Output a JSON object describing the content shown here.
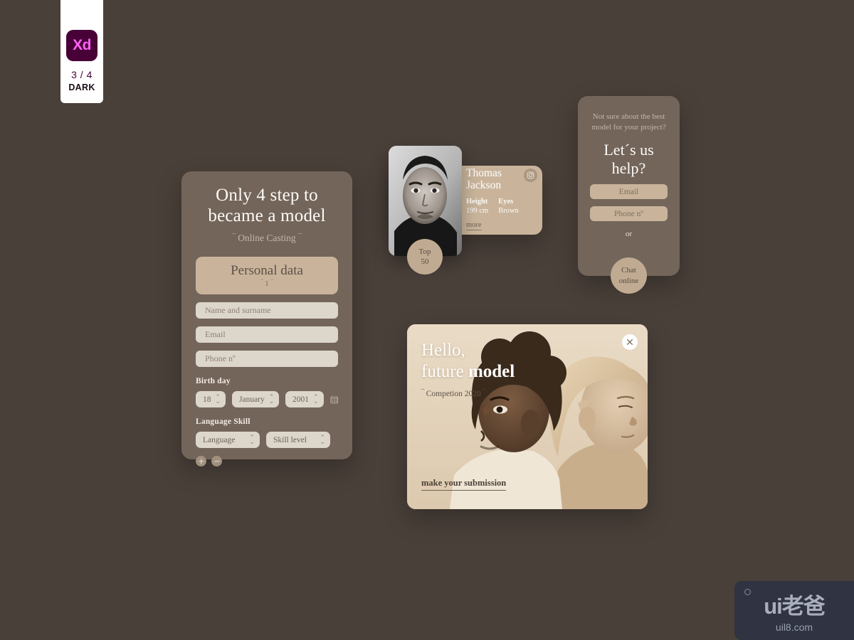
{
  "badge": {
    "app": "Xd",
    "count": "3 / 4",
    "mode": "DARK"
  },
  "steps_card": {
    "title": "Only 4 step to became a model",
    "subtitle": "‾ Online Casting ‾",
    "step_button": {
      "label": "Personal data",
      "step": "‾ 1 ‾"
    },
    "inputs": [
      {
        "name": "name-surname",
        "placeholder": "Name and surname",
        "value": ""
      },
      {
        "name": "email",
        "placeholder": "Email",
        "value": ""
      },
      {
        "name": "phone",
        "placeholder": "Phone nº",
        "value": ""
      }
    ],
    "birthday": {
      "label": "Birth day",
      "day": "18",
      "month": "January",
      "year": "2001"
    },
    "language": {
      "label": "Language Skill",
      "language_value": "Language",
      "skill_value": "Skill level"
    }
  },
  "model_card": {
    "name": "Thomas Jackson",
    "specs": [
      {
        "label": "Height",
        "value": "199 cm"
      },
      {
        "label": "Eyes",
        "value": "Brown"
      }
    ],
    "more_label": "more",
    "badge": {
      "line1": "Top",
      "line2": "50"
    }
  },
  "help_card": {
    "intro": "Not sure about the best model for your project?",
    "title": "Let´s us help?",
    "email_placeholder": "Email",
    "phone_placeholder": "Phone nº",
    "or_label": "or",
    "chat_button": {
      "line1": "Chat",
      "line2": "online"
    }
  },
  "hero_card": {
    "title_light": "Hello,",
    "title_mixed_light": "future ",
    "title_mixed_bold": "model",
    "subtitle": "‾ Competion 2020 ‾",
    "link": "make your submission"
  },
  "watermark": {
    "logo": "ui老爸",
    "url": "uil8.com"
  },
  "colors": {
    "page_background": "#4a403a",
    "card_surface": "#73655a",
    "accent_tan": "#c9b49b",
    "input_cream": "#ddd6cb",
    "hero_cream": "#e8d9c4",
    "text_light": "#fdfbf8",
    "xd_magenta": "#ff61f6",
    "xd_plum": "#470137"
  }
}
